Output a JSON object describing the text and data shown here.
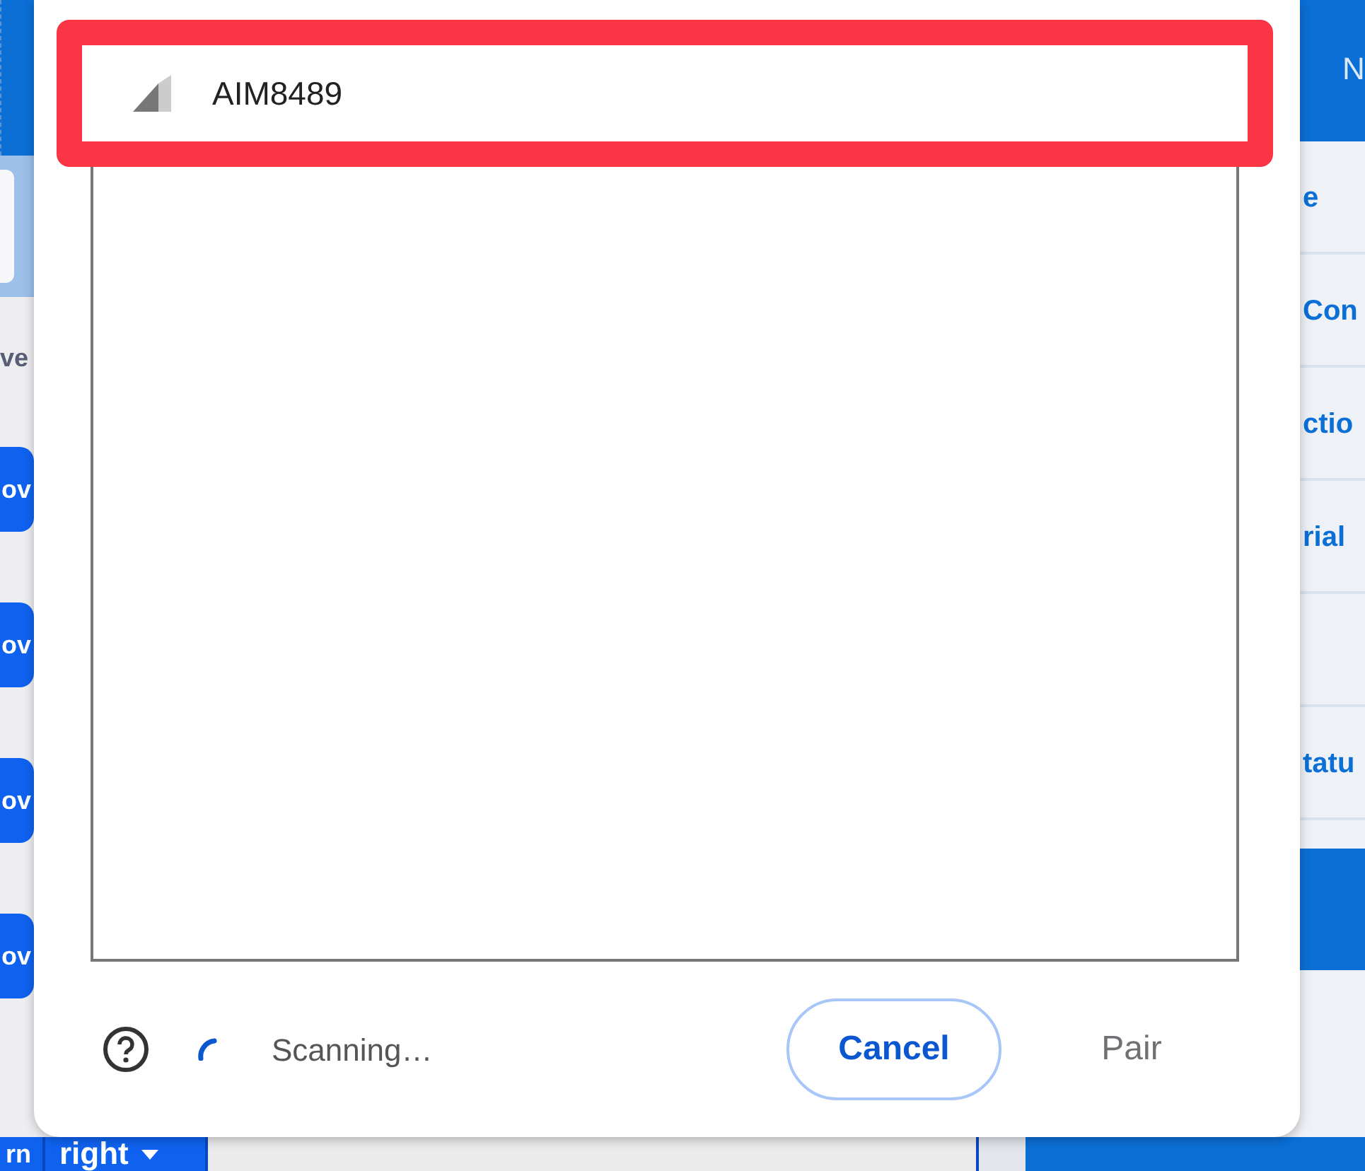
{
  "left_panel": {
    "category_label": "ve",
    "blocks": [
      {
        "label": "ov"
      },
      {
        "label": "ov"
      },
      {
        "label": "ov"
      },
      {
        "label": "ov"
      }
    ],
    "bottom_blocks": [
      {
        "label": "rn",
        "dropdown": false
      },
      {
        "label": "right",
        "dropdown": true
      }
    ]
  },
  "right_panel": {
    "tab": "N",
    "rows": [
      {
        "label": "e"
      },
      {
        "label": "Con"
      },
      {
        "label": "ctio"
      },
      {
        "label": "rial"
      },
      {
        "label": "tatu"
      }
    ]
  },
  "dialog": {
    "devices": [
      {
        "name": "AIM8489",
        "selected": true
      }
    ],
    "scanning": true,
    "status": "Scanning…",
    "buttons": [
      {
        "label": "Cancel",
        "disabled": false
      },
      {
        "label": "Pair",
        "disabled": true
      }
    ]
  }
}
